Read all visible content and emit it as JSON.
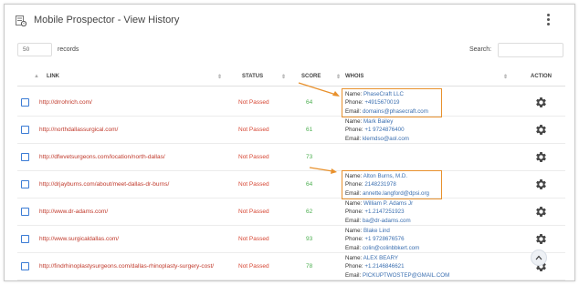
{
  "header": {
    "title": "Mobile Prospector - View History",
    "app_icon": "history-list-icon",
    "menu_icon": "more-vertical-icon"
  },
  "controls": {
    "page_length_value": "50",
    "page_length_label": "records",
    "search_label": "Search:",
    "search_value": ""
  },
  "columns": {
    "link": "LINK",
    "status": "STATUS",
    "score": "SCORE",
    "whois": "WHOIS",
    "action": "ACTION"
  },
  "whois_labels": {
    "name": "Name:",
    "phone": "Phone:",
    "email": "Email:"
  },
  "rows": [
    {
      "link": "http://drrohrich.com/",
      "status": "Not Passed",
      "score": "64",
      "name": "PhaseCraft LLC",
      "phone": "+4915670019",
      "email": "domains@phasecraft.com",
      "highlighted": true
    },
    {
      "link": "http://northdallassurgical.com/",
      "status": "Not Passed",
      "score": "61",
      "name": "Mark Bailey",
      "phone": "+1 9724876400",
      "email": "klemdso@aol.com",
      "highlighted": false
    },
    {
      "link": "http://dfwvetsurgeons.com/location/north-dallas/",
      "status": "Not Passed",
      "score": "73",
      "name": "",
      "phone": "",
      "email": "",
      "highlighted": false
    },
    {
      "link": "http://drjayburns.com/about/meet-dallas-dr-burns/",
      "status": "Not Passed",
      "score": "64",
      "name": "Alton Burns, M.D.",
      "phone": "2148231978",
      "email": "annette.langford@dpsi.org",
      "highlighted": true
    },
    {
      "link": "http://www.dr-adams.com/",
      "status": "Not Passed",
      "score": "62",
      "name": "William P. Adams Jr",
      "phone": "+1.2147251923",
      "email": "ba@dr-adams.com",
      "highlighted": false
    },
    {
      "link": "http://www.surgicaldallas.com/",
      "status": "Not Passed",
      "score": "93",
      "name": "Blake Lind",
      "phone": "+1 9728676576",
      "email": "colin@colinbbkert.com",
      "highlighted": false
    },
    {
      "link": "http://findrhinoplastysurgeons.com/dallas-rhinoplasty-surgery-cost/",
      "status": "Not Passed",
      "score": "78",
      "name": "ALEX BEARY",
      "phone": "+1.2146846621",
      "email": "PICKUPTWOSTEP@GMAIL.COM",
      "highlighted": false
    }
  ],
  "colors": {
    "link": "#c0392b",
    "status": "#d64532",
    "score": "#4caf50",
    "whois_value": "#3b6fb0",
    "highlight": "#e8912d"
  }
}
